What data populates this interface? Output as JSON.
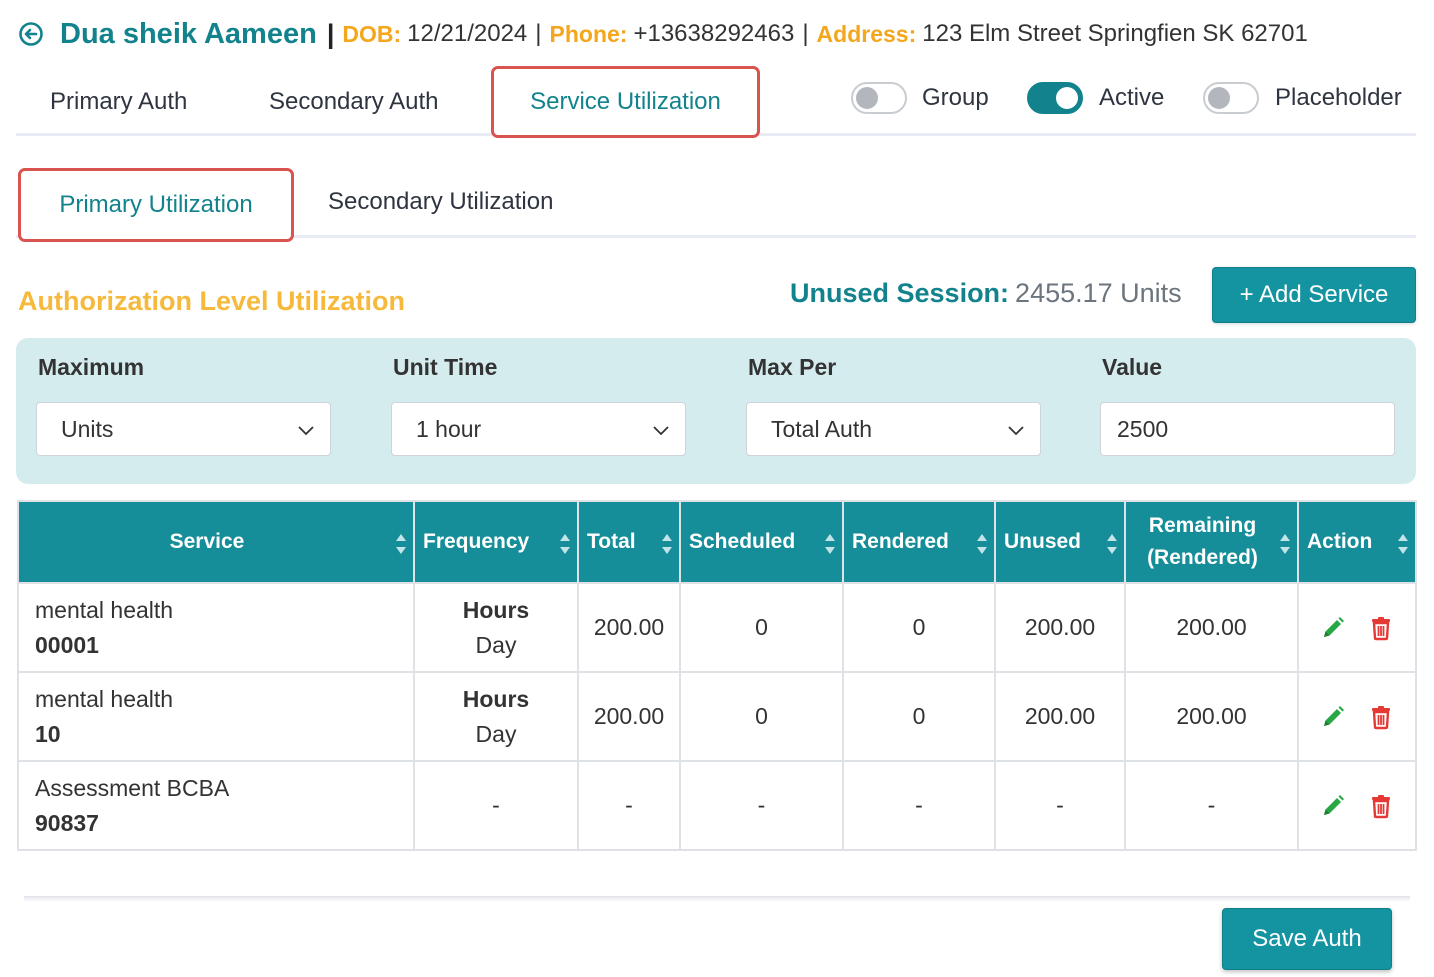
{
  "patient": {
    "name": "Dua sheik Aameen",
    "dob_label": "DOB:",
    "dob": "12/21/2024",
    "phone_label": "Phone:",
    "phone": "+13638292463",
    "address_label": "Address:",
    "address": "123 Elm Street Springfien SK 62701",
    "separator": "|"
  },
  "main_tabs": [
    {
      "label": "Primary Auth",
      "active": false
    },
    {
      "label": "Secondary Auth",
      "active": false
    },
    {
      "label": "Service Utilization",
      "active": true
    }
  ],
  "toggles": [
    {
      "label": "Group",
      "on": false
    },
    {
      "label": "Active",
      "on": true
    },
    {
      "label": "Placeholder",
      "on": false
    }
  ],
  "sub_tabs": [
    {
      "label": "Primary Utilization",
      "active": true
    },
    {
      "label": "Secondary Utilization",
      "active": false
    }
  ],
  "section": {
    "title": "Authorization Level Utilization",
    "unused_label": "Unused Session:",
    "unused_value": "2455.17 Units",
    "add_button": "+ Add Service"
  },
  "filters": {
    "maximum": {
      "label": "Maximum",
      "value": "Units"
    },
    "unit_time": {
      "label": "Unit Time",
      "value": "1 hour"
    },
    "max_per": {
      "label": "Max Per",
      "value": "Total Auth"
    },
    "value": {
      "label": "Value",
      "value": "2500"
    }
  },
  "table": {
    "headers": {
      "service": "Service",
      "frequency": "Frequency",
      "total": "Total",
      "scheduled": "Scheduled",
      "rendered": "Rendered",
      "unused": "Unused",
      "remaining_1": "Remaining",
      "remaining_2": "(Rendered)",
      "action": "Action"
    },
    "rows": [
      {
        "service": "mental health",
        "code": "00001",
        "freq_unit": "Hours",
        "freq_per": "Day",
        "total": "200.00",
        "scheduled": "0",
        "rendered": "0",
        "unused": "200.00",
        "remaining": "200.00"
      },
      {
        "service": "mental health",
        "code": "10",
        "freq_unit": "Hours",
        "freq_per": "Day",
        "total": "200.00",
        "scheduled": "0",
        "rendered": "0",
        "unused": "200.00",
        "remaining": "200.00"
      },
      {
        "service": "Assessment BCBA",
        "code": "90837",
        "freq_unit": "",
        "freq_per": "-",
        "total": "-",
        "scheduled": "-",
        "rendered": "-",
        "unused": "-",
        "remaining": "-"
      }
    ]
  },
  "footer": {
    "save_button": "Save Auth"
  },
  "colors": {
    "teal": "#12838d",
    "orange": "#f4a61d",
    "gold": "#f6b93b",
    "red": "#d9534f",
    "panel": "#d5ecef"
  }
}
